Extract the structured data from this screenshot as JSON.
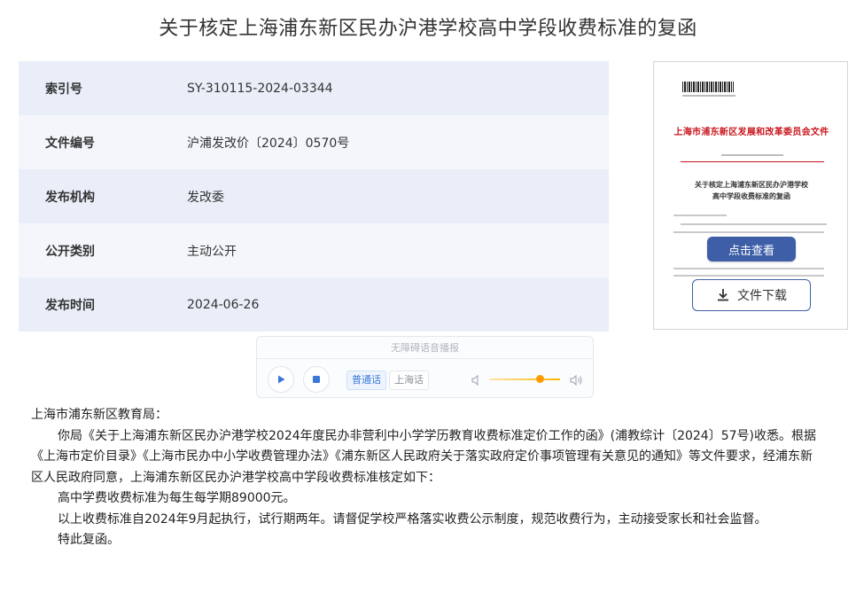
{
  "page": {
    "title": "关于核定上海浦东新区民办沪港学校高中学段收费标准的复函"
  },
  "meta": [
    {
      "key": "索引号",
      "value": "SY-310115-2024-03344"
    },
    {
      "key": "文件编号",
      "value": "沪浦发改价〔2024〕0570号"
    },
    {
      "key": "发布机构",
      "value": "发改委"
    },
    {
      "key": "公开类别",
      "value": "主动公开"
    },
    {
      "key": "发布时间",
      "value": "2024-06-26"
    }
  ],
  "preview": {
    "header": "上海市浦东新区发展和改革委员会文件",
    "subtitle_line1": "关于核定上海浦东新区民办沪港学校",
    "subtitle_line2": "高中学段收费标准的复函",
    "view_button": "点击查看",
    "download_button": "文件下载"
  },
  "player": {
    "title": "无障碍语音播报",
    "dialects": [
      "普通话",
      "上海话"
    ],
    "volume_level": 0.72
  },
  "body": {
    "salutation": "上海市浦东新区教育局：",
    "p1": "你局《关于上海浦东新区民办沪港学校2024年度民办非营利中小学学历教育收费标准定价工作的函》(浦教综计〔2024〕57号)收悉。根据《上海市定价目录》《上海市民办中小学收费管理办法》《浦东新区人民政府关于落实政府定价事项管理有关意见的通知》等文件要求，经浦东新区人民政府同意，上海浦东新区民办沪港学校高中学段收费标准核定如下：",
    "p2": "高中学费收费标准为每生每学期89000元。",
    "p3": "以上收费标准自2024年9月起执行，试行期两年。请督促学校严格落实收费公示制度，规范收费行为，主动接受家长和社会监督。",
    "p4": "特此复函。"
  },
  "colors": {
    "accent": "#3e5fa8",
    "doc_red": "#c8161d",
    "row_odd": "#e9eef9",
    "row_even": "#f4f6fb"
  }
}
